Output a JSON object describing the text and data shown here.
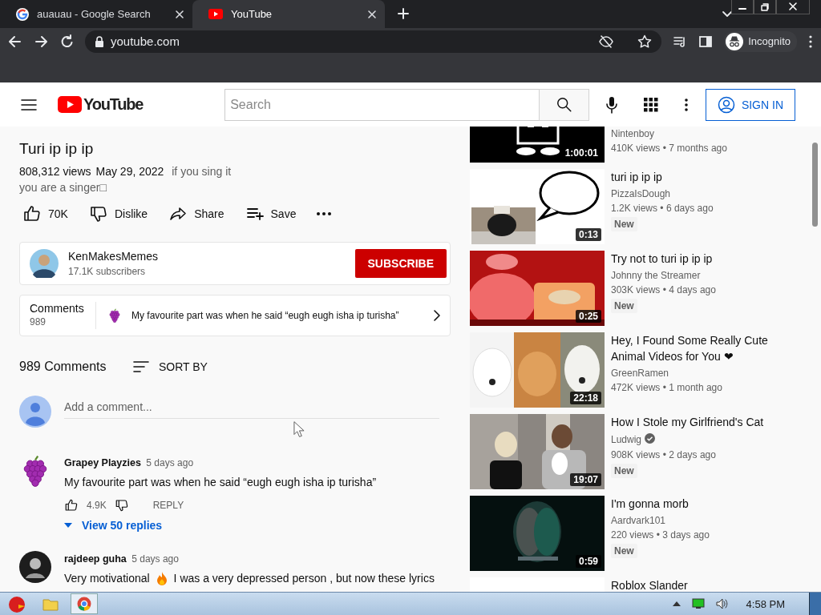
{
  "browser": {
    "tabs": [
      {
        "title": "auauau - Google Search",
        "selected": false
      },
      {
        "title": "YouTube",
        "selected": true
      }
    ],
    "url": "youtube.com",
    "profile": "Incognito"
  },
  "header": {
    "logo": "YouTube",
    "search_placeholder": "Search",
    "sign_in": "SIGN IN"
  },
  "video": {
    "title": "Turi ip ip ip",
    "views": "808,312 views",
    "date": "May 29, 2022",
    "description": [
      "if you sing it",
      "you are a singer□"
    ],
    "actions": [
      {
        "kind": "like",
        "label": "70K"
      },
      {
        "kind": "dislike",
        "label": "Dislike"
      },
      {
        "kind": "share",
        "label": "Share"
      },
      {
        "kind": "save",
        "label": "Save"
      },
      {
        "kind": "more"
      }
    ]
  },
  "channel": {
    "name": "KenMakesMemes",
    "subscribers": "17.1K subscribers",
    "subscribe": "SUBSCRIBE"
  },
  "comments_teaser": {
    "title": "Comments",
    "count": "989",
    "preview": "My favourite part was when he said “eugh eugh isha ip turisha”"
  },
  "comments": {
    "count": "989 Comments",
    "sort": "SORT BY",
    "placeholder": "Add a comment...",
    "items": [
      {
        "author": "Grapey Playzies",
        "time": "5 days ago",
        "text": [
          "My favourite part was when he said “eugh eugh isha ip turisha”"
        ],
        "likes": "4.9K",
        "reply": "REPLY",
        "replies": "View 50 replies"
      },
      {
        "author": "rajdeep guha",
        "time": "5 days ago",
        "text": [
          "Very motivational",
          "I was a very depressed person , but now these lyrics"
        ]
      }
    ]
  },
  "recommendations": [
    {
      "channel": "Nintenboy",
      "verified": false,
      "meta": "410K views • 7 months ago",
      "duration": "1:00:01"
    },
    {
      "title": "turi ip ip ip",
      "channel": "PizzaIsDough",
      "verified": false,
      "meta": "1.2K views • 6 days ago",
      "badge": "New",
      "duration": "0:13"
    },
    {
      "title": "Try not to turi ip ip ip",
      "channel": "Johnny the Streamer",
      "verified": false,
      "meta": "303K views • 4 days ago",
      "badge": "New",
      "duration": "0:25"
    },
    {
      "title": "Hey, I Found Some Really Cute Animal Videos for You ❤",
      "channel": "GreenRamen",
      "verified": false,
      "meta": "472K views • 1 month ago",
      "duration": "22:18"
    },
    {
      "title": "How I Stole my Girlfriend's Cat",
      "channel": "Ludwig",
      "verified": true,
      "meta": "908K views • 2 days ago",
      "badge": "New",
      "duration": "19:07"
    },
    {
      "title": "I'm gonna morb",
      "channel": "Aardvark101",
      "verified": false,
      "meta": "220 views • 3 days ago",
      "badge": "New",
      "duration": "0:59"
    },
    {
      "title": "Roblox Slander",
      "verified": false
    }
  ],
  "taskbar": {
    "time": "4:58 PM"
  }
}
